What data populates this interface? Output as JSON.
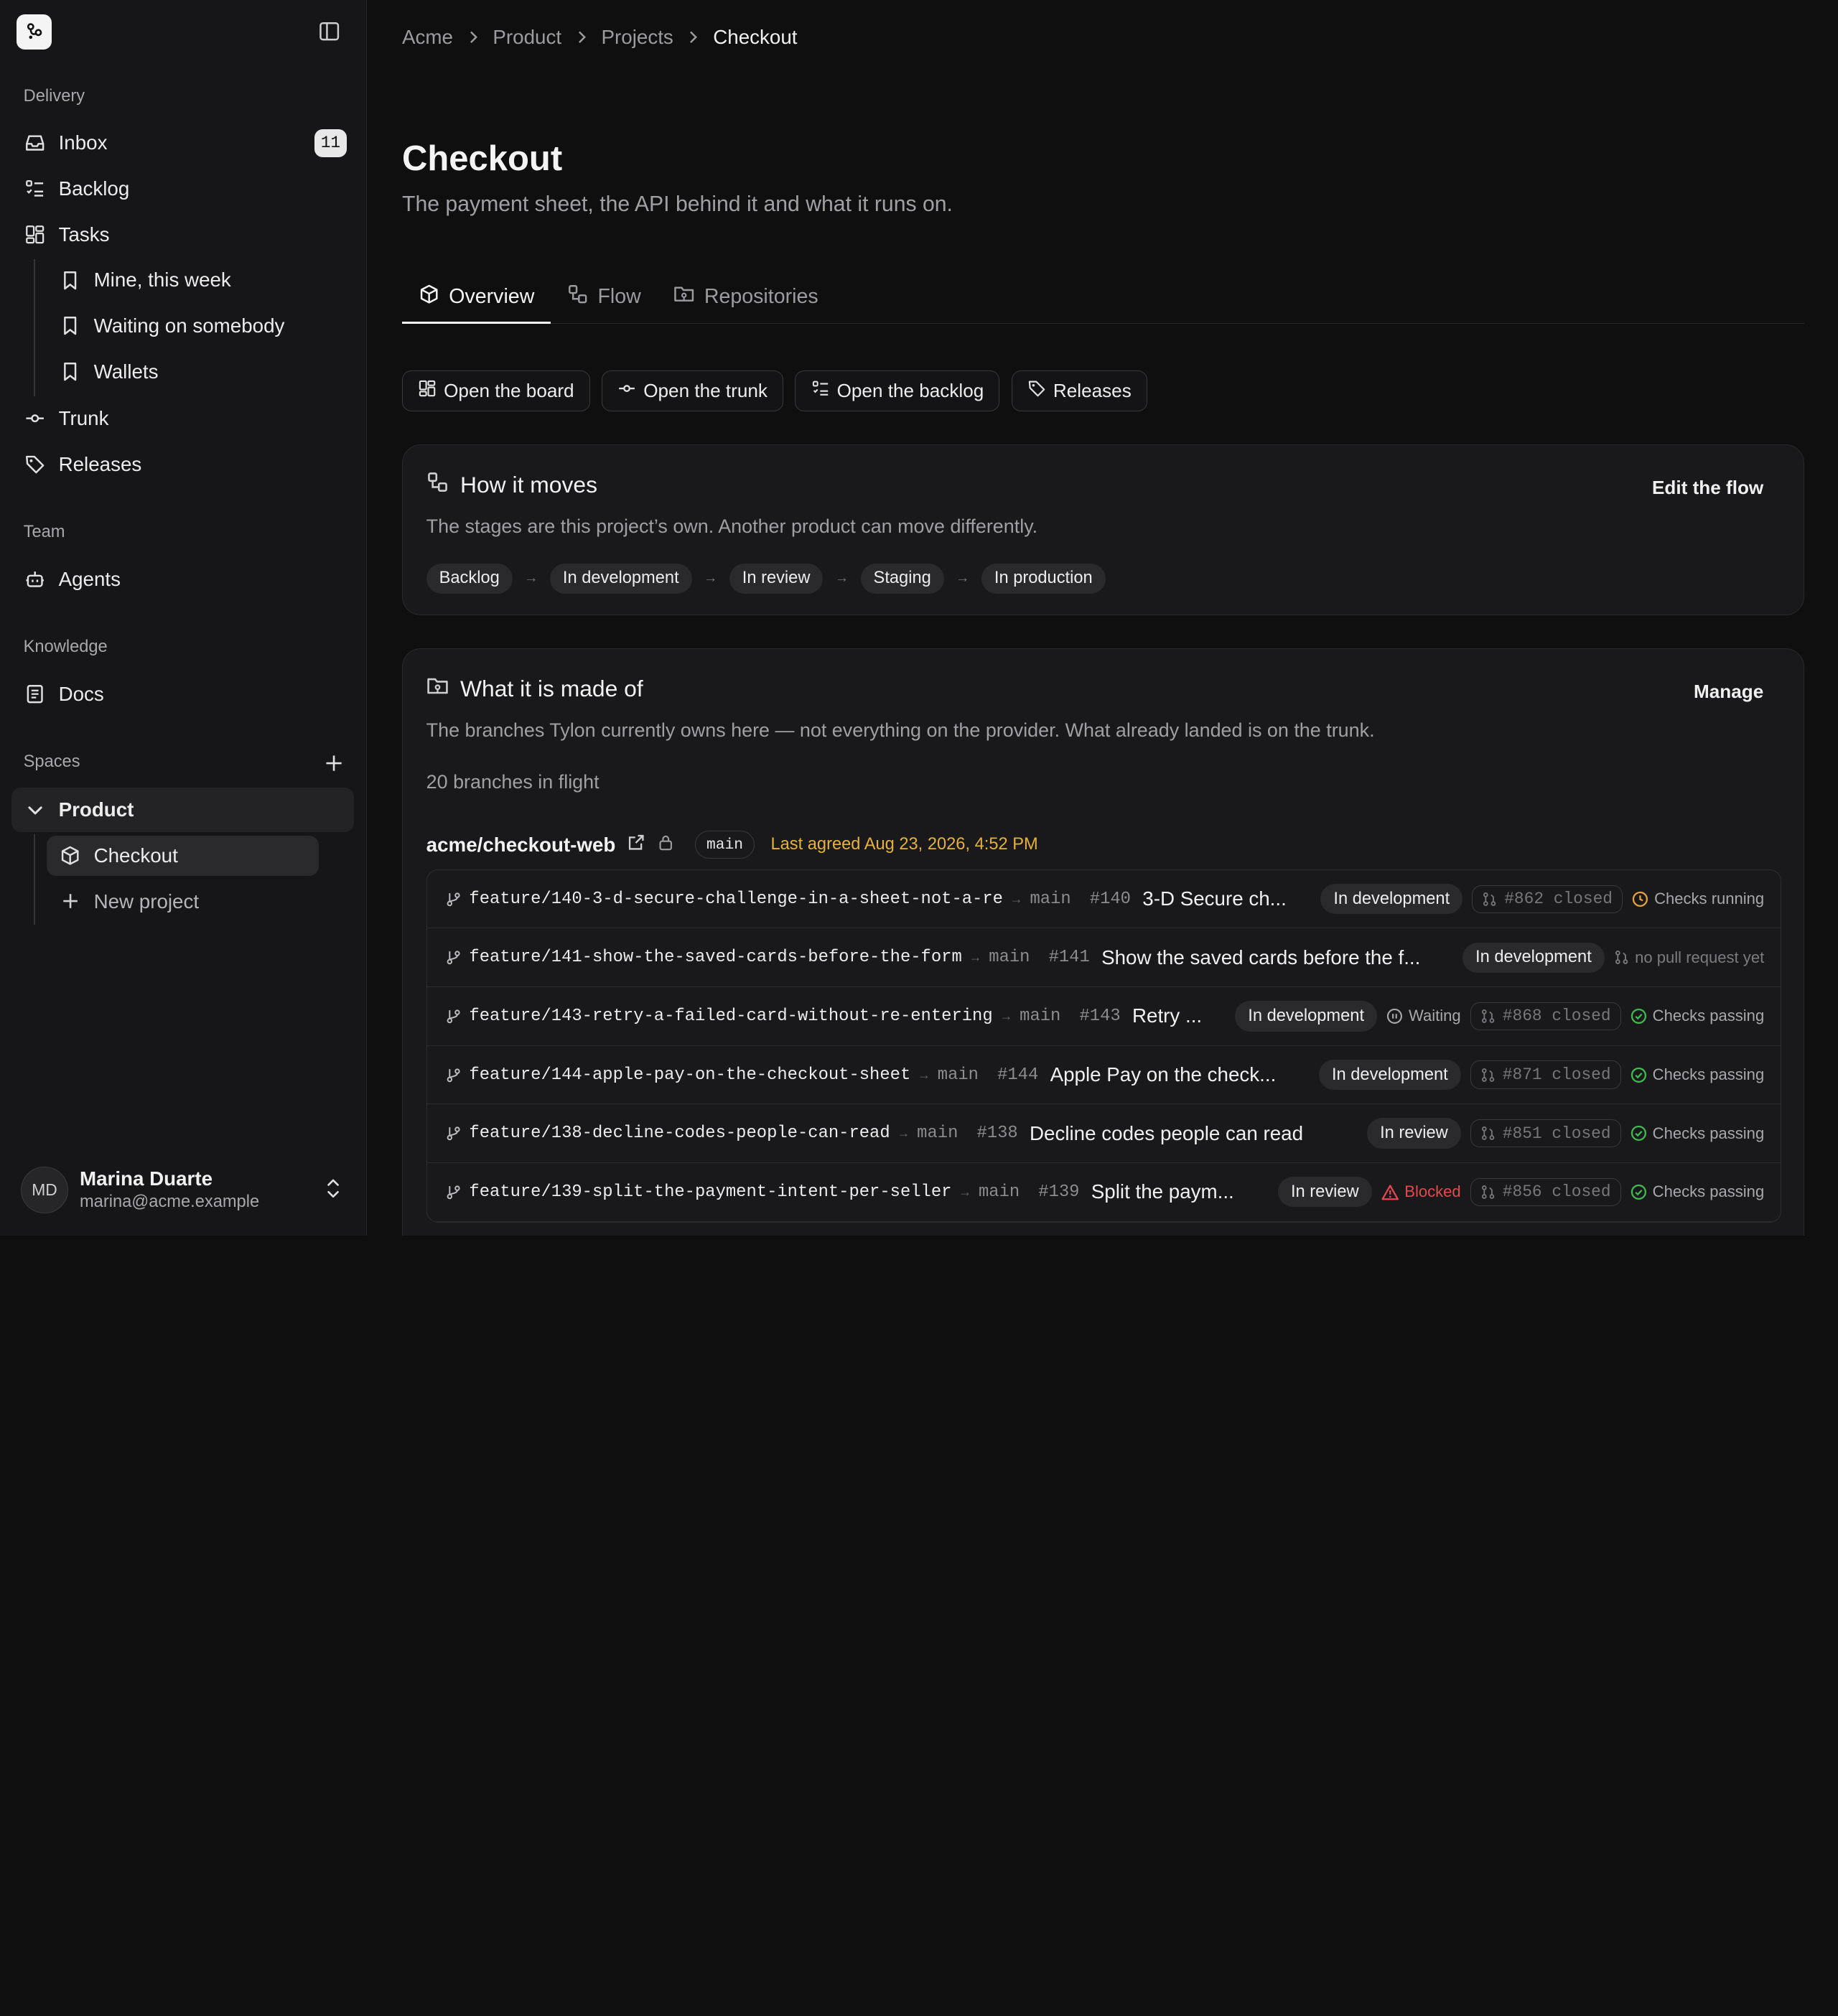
{
  "sidebar": {
    "sections": {
      "delivery": "Delivery",
      "team": "Team",
      "knowledge": "Knowledge",
      "spaces": "Spaces"
    },
    "items": {
      "inbox": "Inbox",
      "inbox_count": "11",
      "backlog": "Backlog",
      "tasks": "Tasks",
      "mine": "Mine, this week",
      "waiting": "Waiting on somebody",
      "wallets": "Wallets",
      "trunk": "Trunk",
      "releases": "Releases",
      "agents": "Agents",
      "docs": "Docs",
      "product": "Product",
      "checkout": "Checkout",
      "new_project": "New project"
    },
    "user": {
      "initials": "MD",
      "name": "Marina Duarte",
      "email": "marina@acme.example"
    }
  },
  "breadcrumb": [
    "Acme",
    "Product",
    "Projects",
    "Checkout"
  ],
  "page": {
    "title": "Checkout",
    "subtitle": "The payment sheet, the API behind it and what it runs on."
  },
  "tabs": [
    "Overview",
    "Flow",
    "Repositories"
  ],
  "actions": [
    "Open the board",
    "Open the trunk",
    "Open the backlog",
    "Releases"
  ],
  "flow_card": {
    "title": "How it moves",
    "link": "Edit the flow",
    "description": "The stages are this project’s own. Another product can move differently.",
    "stages": [
      "Backlog",
      "In development",
      "In review",
      "Staging",
      "In production"
    ],
    "arrow": "→"
  },
  "made_card": {
    "title": "What it is made of",
    "link": "Manage",
    "description": "The branches Tylon currently owns here — not everything on the provider. What already landed is on the trunk.",
    "count": "20 branches in flight",
    "repo": {
      "name": "acme/checkout-web",
      "default_branch": "main",
      "agreed": "Last agreed Aug 23, 2026, 4:52 PM"
    },
    "branches": [
      {
        "name": "feature/140-3-d-secure-challenge-in-a-sheet-not-a-re",
        "target": "main",
        "num": "#140",
        "title": "3-D Secure ch...",
        "stage": "In development",
        "extra": "",
        "extra_type": "",
        "pr": "#862 closed",
        "check": "Checks running",
        "check_type": "running"
      },
      {
        "name": "feature/141-show-the-saved-cards-before-the-form",
        "target": "main",
        "num": "#141",
        "title": "Show the saved cards before the f...",
        "stage": "In development",
        "extra": "",
        "extra_type": "",
        "pr": "",
        "check": "no pull request yet",
        "check_type": "none"
      },
      {
        "name": "feature/143-retry-a-failed-card-without-re-entering",
        "target": "main",
        "num": "#143",
        "title": "Retry ...",
        "stage": "In development",
        "extra": "Waiting",
        "extra_type": "waiting",
        "pr": "#868 closed",
        "check": "Checks passing",
        "check_type": "passing"
      },
      {
        "name": "feature/144-apple-pay-on-the-checkout-sheet",
        "target": "main",
        "num": "#144",
        "title": "Apple Pay on the check...",
        "stage": "In development",
        "extra": "",
        "extra_type": "",
        "pr": "#871 closed",
        "check": "Checks passing",
        "check_type": "passing"
      },
      {
        "name": "feature/138-decline-codes-people-can-read",
        "target": "main",
        "num": "#138",
        "title": "Decline codes people can read",
        "stage": "In review",
        "extra": "",
        "extra_type": "",
        "pr": "#851 closed",
        "check": "Checks passing",
        "check_type": "passing"
      },
      {
        "name": "feature/139-split-the-payment-intent-per-seller",
        "target": "main",
        "num": "#139",
        "title": "Split the paym...",
        "stage": "In review",
        "extra": "Blocked",
        "extra_type": "blocked",
        "pr": "#856 closed",
        "check": "Checks passing",
        "check_type": "passing"
      }
    ]
  },
  "colors": {
    "accent_warning": "#e5b13a",
    "checks_passing": "#3fb950",
    "checks_running": "#e5a23a",
    "blocked": "#e5484d"
  },
  "icons": {
    "branch": "git-branch-icon",
    "pull_request": "pull-request-icon",
    "external": "external-link-icon",
    "lock": "lock-icon"
  }
}
